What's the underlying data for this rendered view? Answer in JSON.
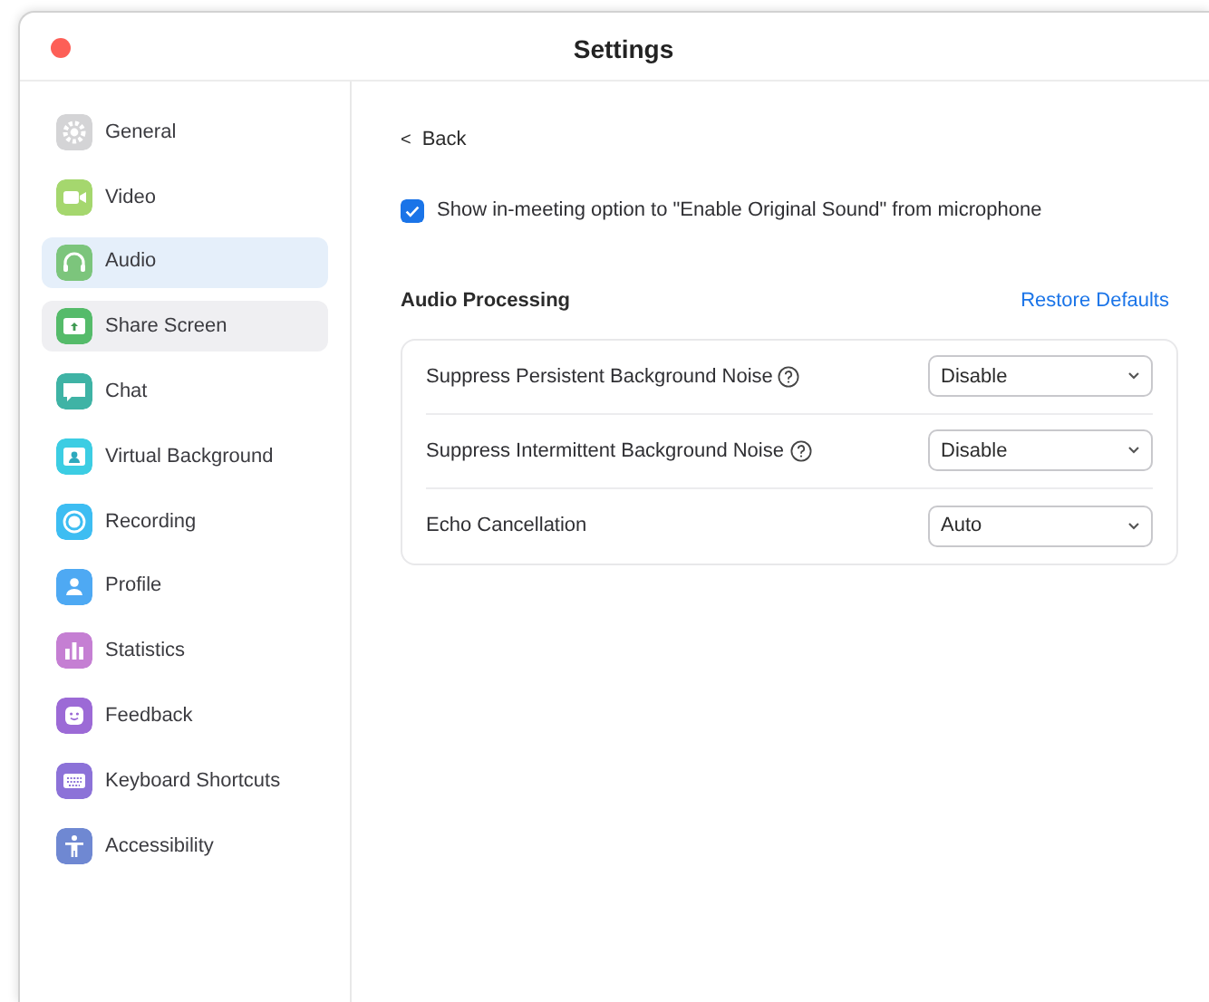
{
  "window": {
    "title": "Settings"
  },
  "sidebar": {
    "items": [
      {
        "label": "General",
        "kind": "gear",
        "color": "#d4d4d6",
        "selected": false,
        "hovered": false
      },
      {
        "label": "Video",
        "kind": "camera",
        "color": "#a5d76e",
        "selected": false,
        "hovered": false
      },
      {
        "label": "Audio",
        "kind": "headphones",
        "color": "#7cc57c",
        "selected": true,
        "hovered": false
      },
      {
        "label": "Share Screen",
        "kind": "share",
        "color": "#55bb6a",
        "selected": false,
        "hovered": true
      },
      {
        "label": "Chat",
        "kind": "chat",
        "color": "#3fb3a5",
        "selected": false,
        "hovered": false
      },
      {
        "label": "Virtual Background",
        "kind": "person-frame",
        "color": "#3ccde3",
        "selected": false,
        "hovered": false
      },
      {
        "label": "Recording",
        "kind": "record",
        "color": "#3dbdf2",
        "selected": false,
        "hovered": false
      },
      {
        "label": "Profile",
        "kind": "person",
        "color": "#4ea9f3",
        "selected": false,
        "hovered": false
      },
      {
        "label": "Statistics",
        "kind": "bars",
        "color": "#c57fd3",
        "selected": false,
        "hovered": false
      },
      {
        "label": "Feedback",
        "kind": "smile",
        "color": "#9c6ad6",
        "selected": false,
        "hovered": false
      },
      {
        "label": "Keyboard Shortcuts",
        "kind": "keyboard",
        "color": "#8c72d8",
        "selected": false,
        "hovered": false
      },
      {
        "label": "Accessibility",
        "kind": "accessibility",
        "color": "#6f88d2",
        "selected": false,
        "hovered": false
      }
    ]
  },
  "content": {
    "back": {
      "icon": "<",
      "label": "Back"
    },
    "original_sound": {
      "label": "Show in-meeting option to \"Enable Original Sound\" from microphone",
      "checked": true
    },
    "section": {
      "title": "Audio Processing",
      "restore": "Restore Defaults"
    },
    "settings": [
      {
        "label": "Suppress Persistent Background Noise",
        "help": true,
        "value": "Disable"
      },
      {
        "label": "Suppress Intermittent Background Noise",
        "help": true,
        "value": "Disable"
      },
      {
        "label": "Echo Cancellation",
        "help": false,
        "value": "Auto"
      }
    ]
  }
}
